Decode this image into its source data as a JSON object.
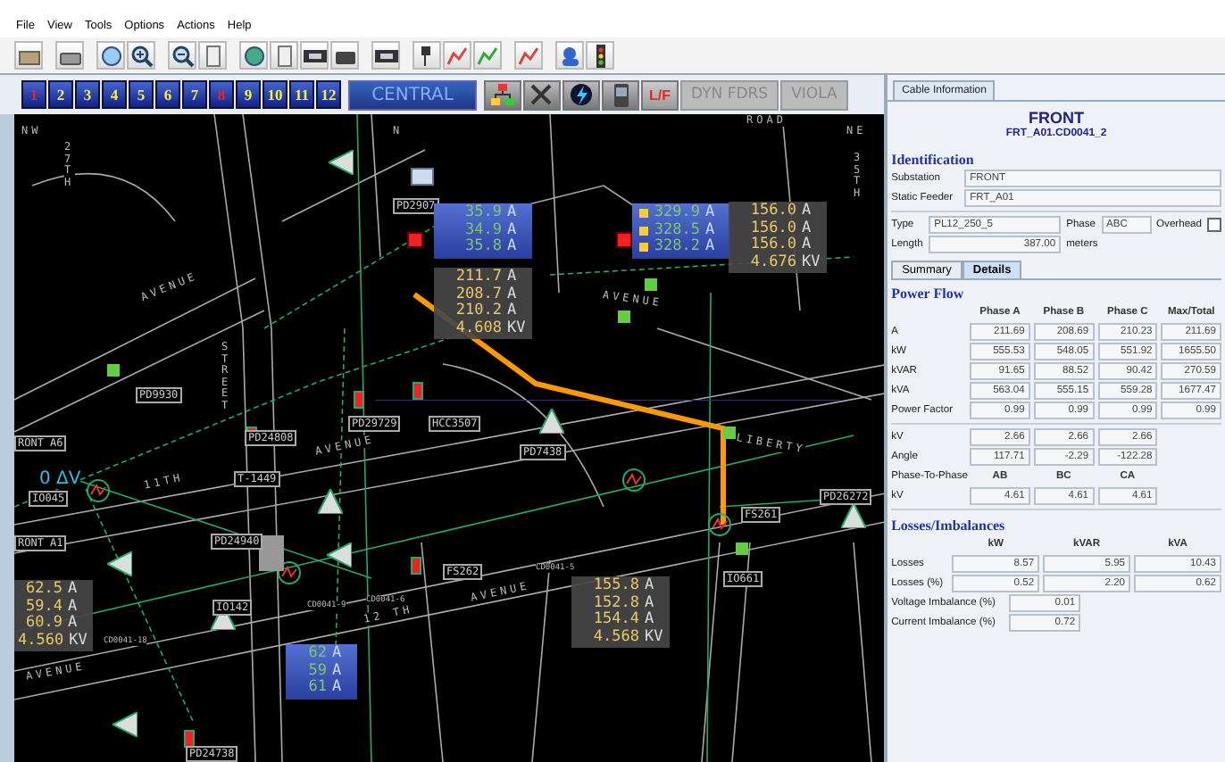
{
  "menu": [
    "File",
    "View",
    "Tools",
    "Options",
    "Actions",
    "Help"
  ],
  "zones": [
    {
      "label": "1",
      "alert": true
    },
    {
      "label": "2",
      "alert": false
    },
    {
      "label": "3",
      "alert": false
    },
    {
      "label": "4",
      "alert": false
    },
    {
      "label": "5",
      "alert": false
    },
    {
      "label": "6",
      "alert": false
    },
    {
      "label": "7",
      "alert": false
    },
    {
      "label": "8",
      "alert": true
    },
    {
      "label": "9",
      "alert": false
    },
    {
      "label": "10",
      "alert": false
    },
    {
      "label": "11",
      "alert": false
    },
    {
      "label": "12",
      "alert": false
    }
  ],
  "region_button": "CENTRAL",
  "lf_button": "L/F",
  "mode_buttons": [
    "DYN FDRS",
    "VIOLA"
  ],
  "map": {
    "streets": [
      "NW",
      "N",
      "ROAD",
      "NE",
      "27TH",
      "AVENUE",
      "AVENUE",
      "35TH",
      "STREET",
      "11TH",
      "AVENUE",
      "12 TH",
      "AVENUE",
      "LIBERTY",
      "AVENUE"
    ],
    "devices": [
      "PD2907",
      "PD9930",
      "PD24808",
      "PD29729",
      "HCC3507",
      "PD7438",
      "RONT A6",
      "IO045",
      "RONT A1",
      "T-1449",
      "PD24940",
      "IO142",
      "FS262",
      "FS261",
      "PD26272",
      "IO661",
      "PD24738"
    ],
    "cables": [
      "CD0041-5",
      "CD0041-6",
      "CD0041-9",
      "CD0041-18"
    ],
    "voltage_drop": "0 ΔV",
    "readouts": [
      {
        "kind": "blue",
        "lines": [
          {
            "value": "35.9",
            "unit": "A"
          },
          {
            "value": "34.9",
            "unit": "A"
          },
          {
            "value": "35.8",
            "unit": "A"
          }
        ]
      },
      {
        "kind": "grey",
        "lines": [
          {
            "value": "211.7",
            "unit": "A"
          },
          {
            "value": "208.7",
            "unit": "A"
          },
          {
            "value": "210.2",
            "unit": "A"
          },
          {
            "value": "4.608",
            "unit": "KV"
          }
        ]
      },
      {
        "kind": "blue",
        "lines": [
          {
            "value": "329.9",
            "unit": "A",
            "marker": true
          },
          {
            "value": "328.5",
            "unit": "A",
            "marker": true
          },
          {
            "value": "328.2",
            "unit": "A",
            "marker": true
          }
        ]
      },
      {
        "kind": "grey",
        "lines": [
          {
            "value": "156.0",
            "unit": "A"
          },
          {
            "value": "156.0",
            "unit": "A"
          },
          {
            "value": "156.0",
            "unit": "A"
          },
          {
            "value": "4.676",
            "unit": "KV"
          }
        ]
      },
      {
        "kind": "grey",
        "lines": [
          {
            "value": "62.5",
            "unit": "A"
          },
          {
            "value": "59.4",
            "unit": "A"
          },
          {
            "value": "60.9",
            "unit": "A"
          },
          {
            "value": "4.560",
            "unit": "KV"
          }
        ]
      },
      {
        "kind": "blue",
        "lines": [
          {
            "value": "62",
            "unit": "A"
          },
          {
            "value": "59",
            "unit": "A"
          },
          {
            "value": "61",
            "unit": "A"
          }
        ]
      },
      {
        "kind": "grey",
        "lines": [
          {
            "value": "155.8",
            "unit": "A"
          },
          {
            "value": "152.8",
            "unit": "A"
          },
          {
            "value": "154.4",
            "unit": "A"
          },
          {
            "value": "4.568",
            "unit": "KV"
          }
        ]
      }
    ]
  },
  "panel": {
    "tab": "Cable Information",
    "title": "FRONT",
    "subtitle": "FRT_A01.CD0041_2",
    "identification": {
      "heading": "Identification",
      "substation_label": "Substation",
      "substation": "FRONT",
      "feeder_label": "Static Feeder",
      "feeder": "FRT_A01",
      "type_label": "Type",
      "type": "PL12_250_5",
      "phase_label": "Phase",
      "phase": "ABC",
      "overhead_label": "Overhead",
      "overhead": false,
      "length_label": "Length",
      "length": "387.00",
      "length_unit": "meters"
    },
    "tabs": [
      {
        "label": "Summary",
        "selected": false
      },
      {
        "label": "Details",
        "selected": true
      }
    ],
    "power_flow": {
      "heading": "Power Flow",
      "columns": [
        "Phase A",
        "Phase B",
        "Phase C",
        "Max/Total"
      ],
      "rows": [
        {
          "label": "A",
          "values": [
            "211.69",
            "208.69",
            "210.23",
            "211.69"
          ]
        },
        {
          "label": "kW",
          "values": [
            "555.53",
            "548.05",
            "551.92",
            "1655.50"
          ]
        },
        {
          "label": "kVAR",
          "values": [
            "91.65",
            "88.52",
            "90.42",
            "270.59"
          ]
        },
        {
          "label": "kVA",
          "values": [
            "563.04",
            "555.15",
            "559.28",
            "1677.47"
          ]
        },
        {
          "label": "Power Factor",
          "values": [
            "0.99",
            "0.99",
            "0.99",
            "0.99"
          ]
        }
      ],
      "voltage_rows": [
        {
          "label": "kV",
          "values": [
            "2.66",
            "2.66",
            "2.66"
          ]
        },
        {
          "label": "Angle",
          "values": [
            "117.71",
            "-2.29",
            "-122.28"
          ]
        }
      ],
      "ptp_label": "Phase-To-Phase",
      "ptp_columns": [
        "AB",
        "BC",
        "CA"
      ],
      "ptp_row": {
        "label": "kV",
        "values": [
          "4.61",
          "4.61",
          "4.61"
        ]
      }
    },
    "losses": {
      "heading": "Losses/Imbalances",
      "columns": [
        "kW",
        "kVAR",
        "kVA"
      ],
      "rows": [
        {
          "label": "Losses",
          "values": [
            "8.57",
            "5.95",
            "10.43"
          ]
        },
        {
          "label": "Losses (%)",
          "values": [
            "0.52",
            "2.20",
            "0.62"
          ]
        }
      ],
      "imbalance": [
        {
          "label": "Voltage Imbalance (%)",
          "value": "0.01"
        },
        {
          "label": "Current Imbalance (%)",
          "value": "0.72"
        }
      ]
    }
  }
}
